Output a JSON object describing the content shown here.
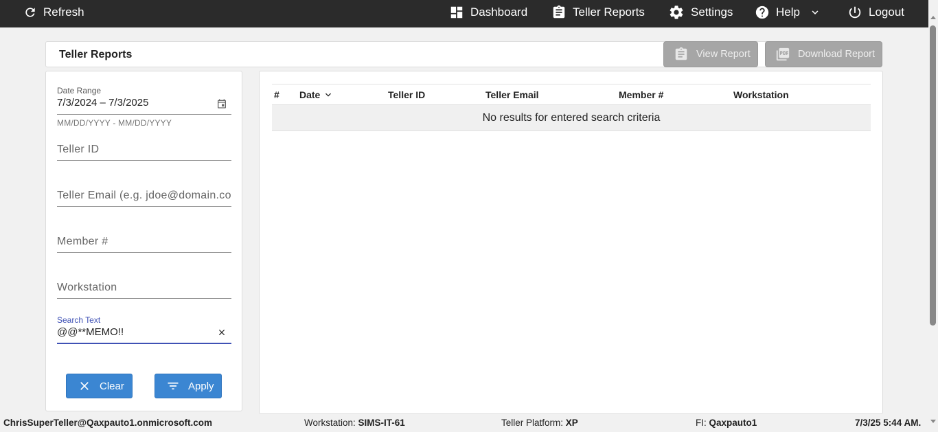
{
  "topbar": {
    "refresh": "Refresh",
    "dashboard": "Dashboard",
    "teller_reports": "Teller Reports",
    "settings": "Settings",
    "help": "Help",
    "logout": "Logout"
  },
  "header": {
    "title": "Teller Reports",
    "view_report": "View Report",
    "download_report": "Download Report"
  },
  "filters": {
    "date_range_label": "Date Range",
    "date_range_value": "7/3/2024 – 7/3/2025",
    "date_range_hint": "MM/DD/YYYY - MM/DD/YYYY",
    "teller_id_placeholder": "Teller ID",
    "teller_email_placeholder": "Teller Email (e.g. jdoe@domain.com)",
    "member_placeholder": "Member #",
    "workstation_placeholder": "Workstation",
    "search_text_label": "Search Text",
    "search_text_value": "@@**MEMO!!",
    "clear_label": "Clear",
    "apply_label": "Apply"
  },
  "table": {
    "columns": [
      "#",
      "Date",
      "Teller ID",
      "Teller Email",
      "Member #",
      "Workstation"
    ],
    "empty_message": "No results for entered search criteria"
  },
  "footer": {
    "user": "ChrisSuperTeller@Qaxpauto1.onmicrosoft.com",
    "workstation_label": "Workstation:",
    "workstation_value": "SIMS-IT-61",
    "platform_label": "Teller Platform:",
    "platform_value": "XP",
    "fi_label": "FI:",
    "fi_value": "Qaxpauto1",
    "datetime": "7/3/25 5:44 AM."
  },
  "colors": {
    "topbar": "#2b2b2b",
    "primary_button": "#3b86d2",
    "disabled_button": "#a6a6a6",
    "focus_underline": "#3f51b5"
  }
}
